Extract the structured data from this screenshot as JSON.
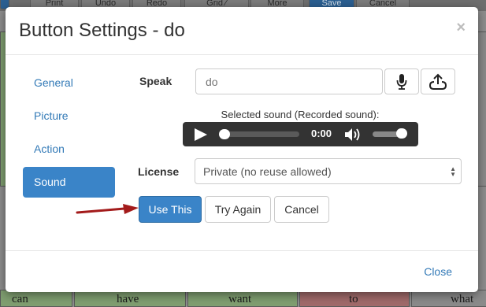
{
  "background": {
    "toolbar_buttons": [
      "Print",
      "Undo",
      "Redo",
      "Grid ⁄",
      "More",
      "Save",
      "Cancel"
    ],
    "words": [
      "can",
      "have",
      "want",
      "to",
      "what"
    ]
  },
  "modal": {
    "title": "Button Settings - do",
    "close_icon": "×",
    "nav": [
      {
        "label": "General"
      },
      {
        "label": "Picture"
      },
      {
        "label": "Action"
      },
      {
        "label": "Sound"
      }
    ],
    "speak": {
      "label": "Speak",
      "placeholder": "do",
      "mic_icon": "microphone-icon",
      "upload_icon": "upload-icon"
    },
    "selected_sound": "Selected sound (Recorded sound):",
    "player": {
      "time": "0:00",
      "progress": 0,
      "volume": 0.8
    },
    "license": {
      "label": "License",
      "value": "Private (no reuse allowed)"
    },
    "buttons": {
      "use_this": "Use This",
      "try_again": "Try Again",
      "cancel": "Cancel"
    },
    "footer": {
      "close": "Close"
    }
  },
  "colors": {
    "primary": "#3a84c8",
    "link": "#337ab7",
    "annotation_arrow": "#a31b1b"
  }
}
